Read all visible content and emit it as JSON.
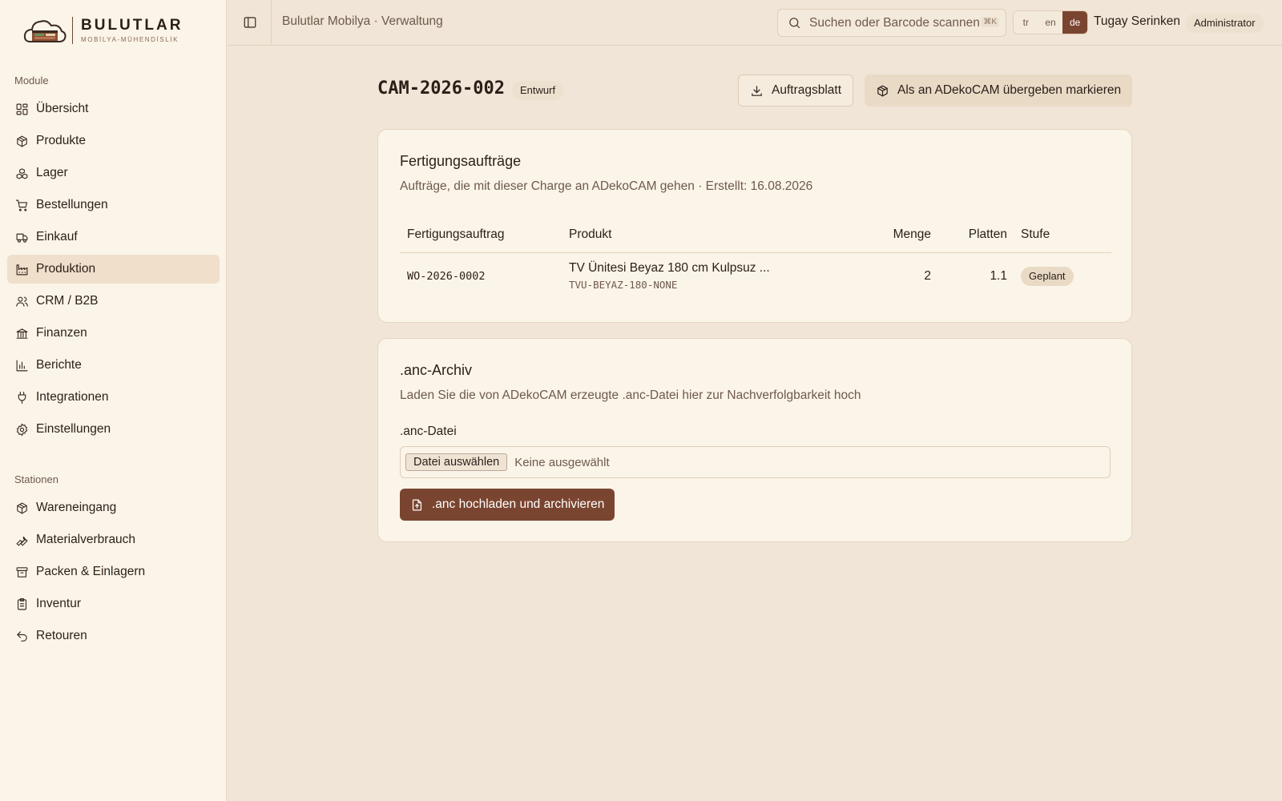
{
  "brand": {
    "name": "BULUTLAR",
    "tagline": "MOBİLYA-MÜHENDİSLİK"
  },
  "sidebar": {
    "modules_label": "Module",
    "modules": [
      {
        "label": "Übersicht",
        "icon": "dashboard-icon"
      },
      {
        "label": "Produkte",
        "icon": "package-icon"
      },
      {
        "label": "Lager",
        "icon": "boxes-icon"
      },
      {
        "label": "Bestellungen",
        "icon": "cart-icon"
      },
      {
        "label": "Einkauf",
        "icon": "truck-icon"
      },
      {
        "label": "Produktion",
        "icon": "factory-icon",
        "active": true
      },
      {
        "label": "CRM / B2B",
        "icon": "users-icon"
      },
      {
        "label": "Finanzen",
        "icon": "bank-icon"
      },
      {
        "label": "Berichte",
        "icon": "bar-chart-icon"
      },
      {
        "label": "Integrationen",
        "icon": "plug-icon"
      },
      {
        "label": "Einstellungen",
        "icon": "gear-icon"
      }
    ],
    "stations_label": "Stationen",
    "stations": [
      {
        "label": "Wareneingang",
        "icon": "package-icon"
      },
      {
        "label": "Materialverbrauch",
        "icon": "wrench-icon"
      },
      {
        "label": "Packen & Einlagern",
        "icon": "archive-icon"
      },
      {
        "label": "Inventur",
        "icon": "clipboard-icon"
      },
      {
        "label": "Retouren",
        "icon": "undo-icon"
      }
    ]
  },
  "header": {
    "breadcrumb": "Bulutlar Mobilya · Verwaltung",
    "search_placeholder": "Suchen oder Barcode scannen",
    "search_shortcut": "⌘K",
    "languages": [
      "tr",
      "en",
      "de"
    ],
    "active_language": "de",
    "user_name": "Tugay Serinken",
    "user_role": "Administrator"
  },
  "page": {
    "title": "CAM-2026-002",
    "status": "Entwurf",
    "print_button": "Auftragsblatt",
    "mark_button": "Als an ADekoCAM übergeben markieren"
  },
  "orders_card": {
    "title": "Fertigungsaufträge",
    "description": "Aufträge, die mit dieser Charge an ADekoCAM gehen · Erstellt: 16.08.2026",
    "columns": [
      "Fertigungsauftrag",
      "Produkt",
      "Menge",
      "Platten",
      "Stufe"
    ],
    "rows": [
      {
        "order": "WO-2026-0002",
        "product": "TV Ünitesi Beyaz 180 cm Kulpsuz ...",
        "sku": "TVU-BEYAZ-180-NONE",
        "quantity": "2",
        "sheets": "1.1",
        "stage": "Geplant"
      }
    ]
  },
  "archive_card": {
    "title": ".anc-Archiv",
    "description": "Laden Sie die von ADekoCAM erzeugte .anc-Datei hier zur Nachverfolgbarkeit hoch",
    "field_label": ".anc-Datei",
    "file_button": "Datei auswählen",
    "file_status": "Keine ausgewählt",
    "upload_button": ".anc hochladen und archivieren"
  }
}
